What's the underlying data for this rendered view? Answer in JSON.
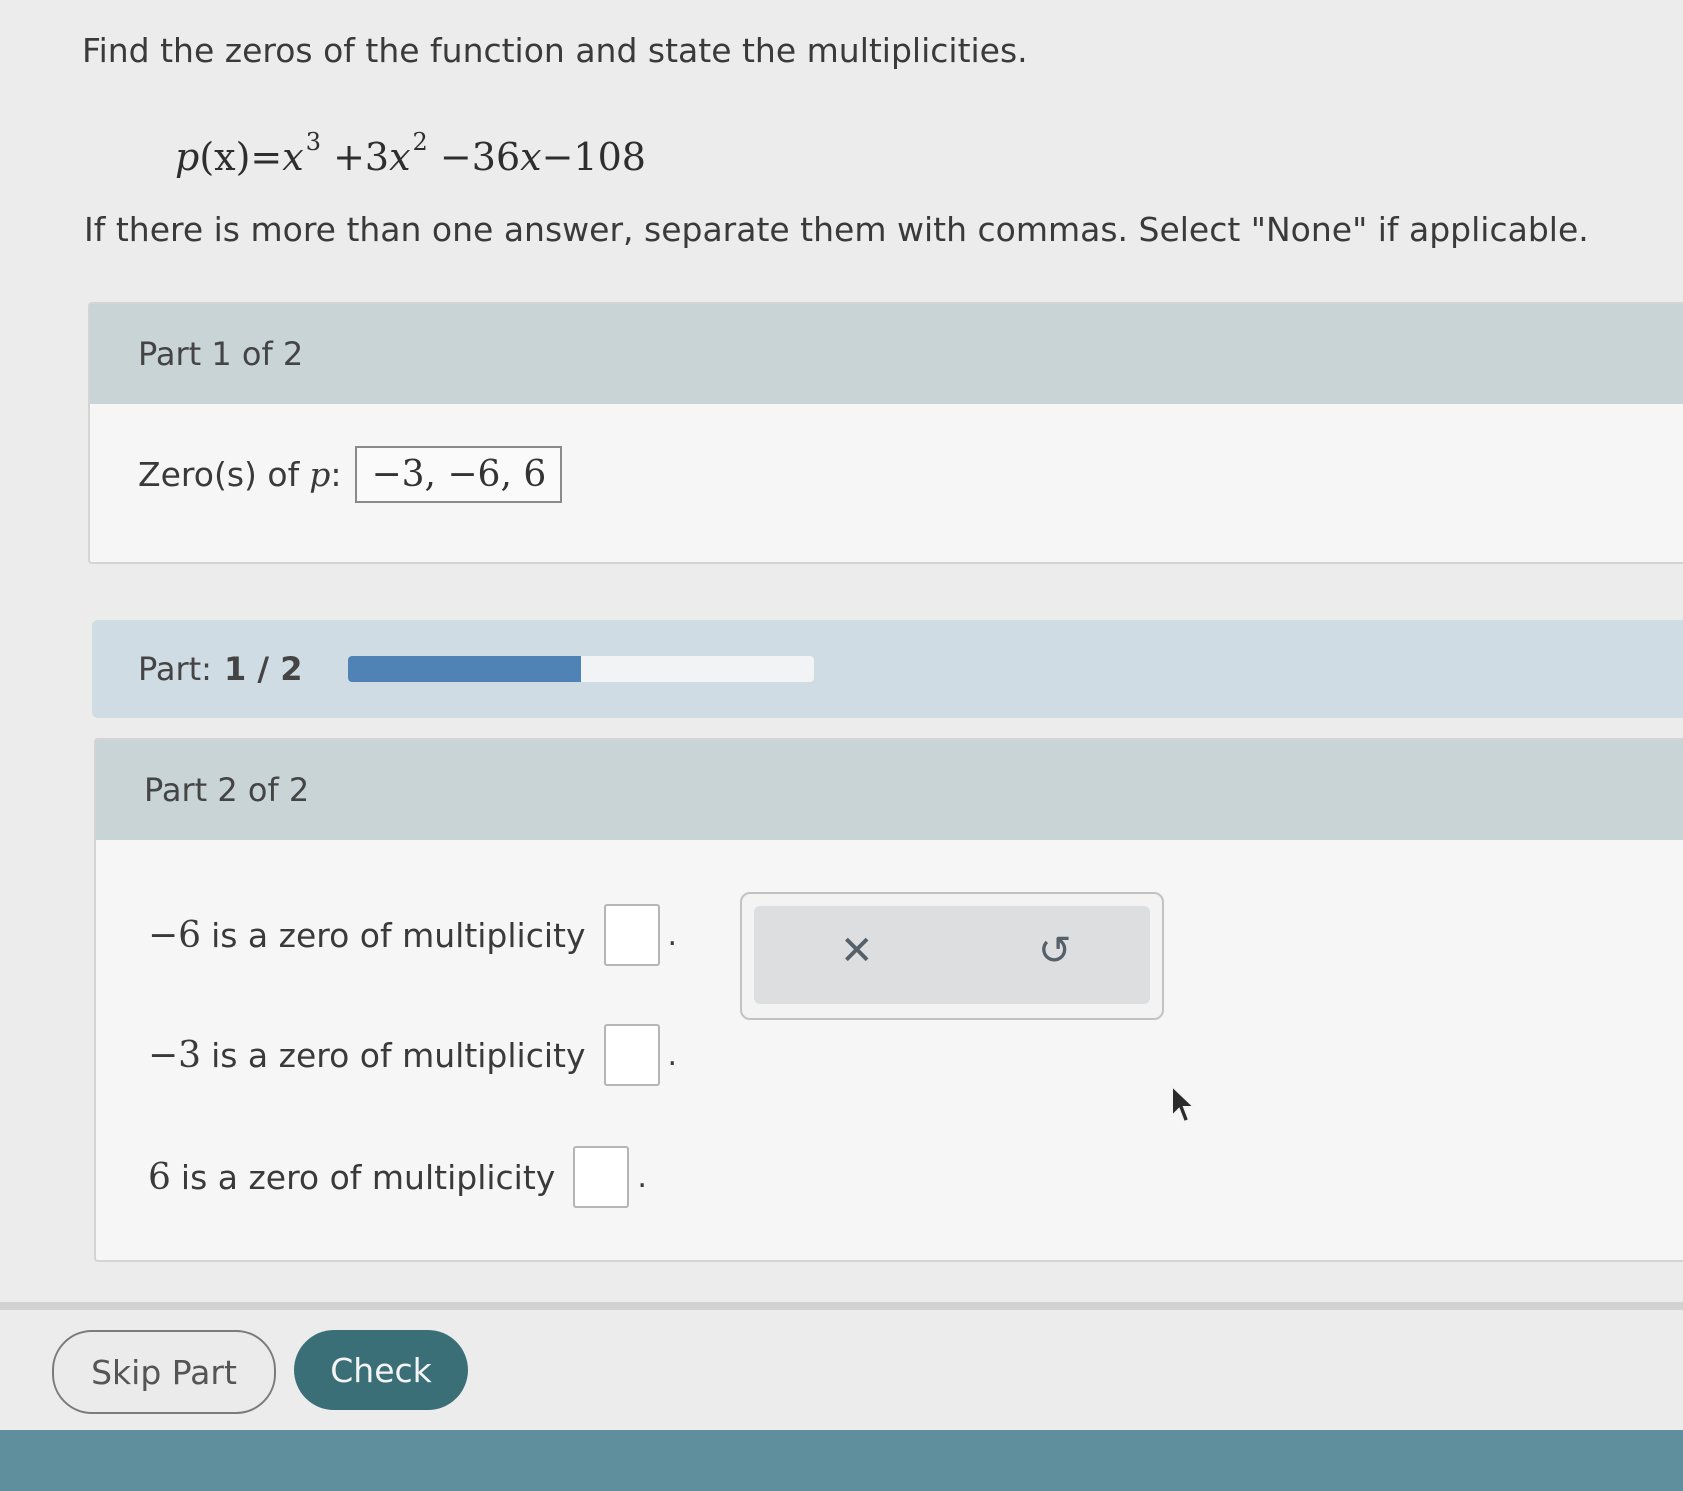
{
  "question": {
    "prompt": "Find the zeros of the function and state the multiplicities.",
    "equation": {
      "lhs": "p",
      "arg": "(x)",
      "eq": "=",
      "t1_var": "x",
      "t1_exp": "3",
      "t2_coef": "+3",
      "t2_var": "x",
      "t2_exp": "2",
      "t3": "−36",
      "t3_var": "x",
      "t4": "−108"
    },
    "note": "If there is more than one answer, separate them with commas. Select \"None\" if applicable."
  },
  "part1": {
    "header": "Part 1 of 2",
    "label": "Zero(s) of",
    "var": "p",
    "colon": ":",
    "answer": "−3, −6, 6"
  },
  "progress": {
    "label": "Part:",
    "value": "1 / 2",
    "fraction": 0.5,
    "fill_color": "#4f83b6"
  },
  "part2": {
    "header": "Part 2 of 2",
    "rows": [
      {
        "zero": "−6",
        "text": "is a zero of multiplicity",
        "dot": "."
      },
      {
        "zero": "−3",
        "text": "is a zero of multiplicity",
        "dot": "."
      },
      {
        "zero": "6",
        "text": "is a zero of multiplicity",
        "dot": "."
      }
    ]
  },
  "toolbox": {
    "clear_icon": "✕",
    "undo_icon": "↺"
  },
  "buttons": {
    "skip": "Skip Part",
    "check": "Check"
  },
  "colors": {
    "check_button": "#3b6f78",
    "header_bg": "#c9d4d7"
  }
}
